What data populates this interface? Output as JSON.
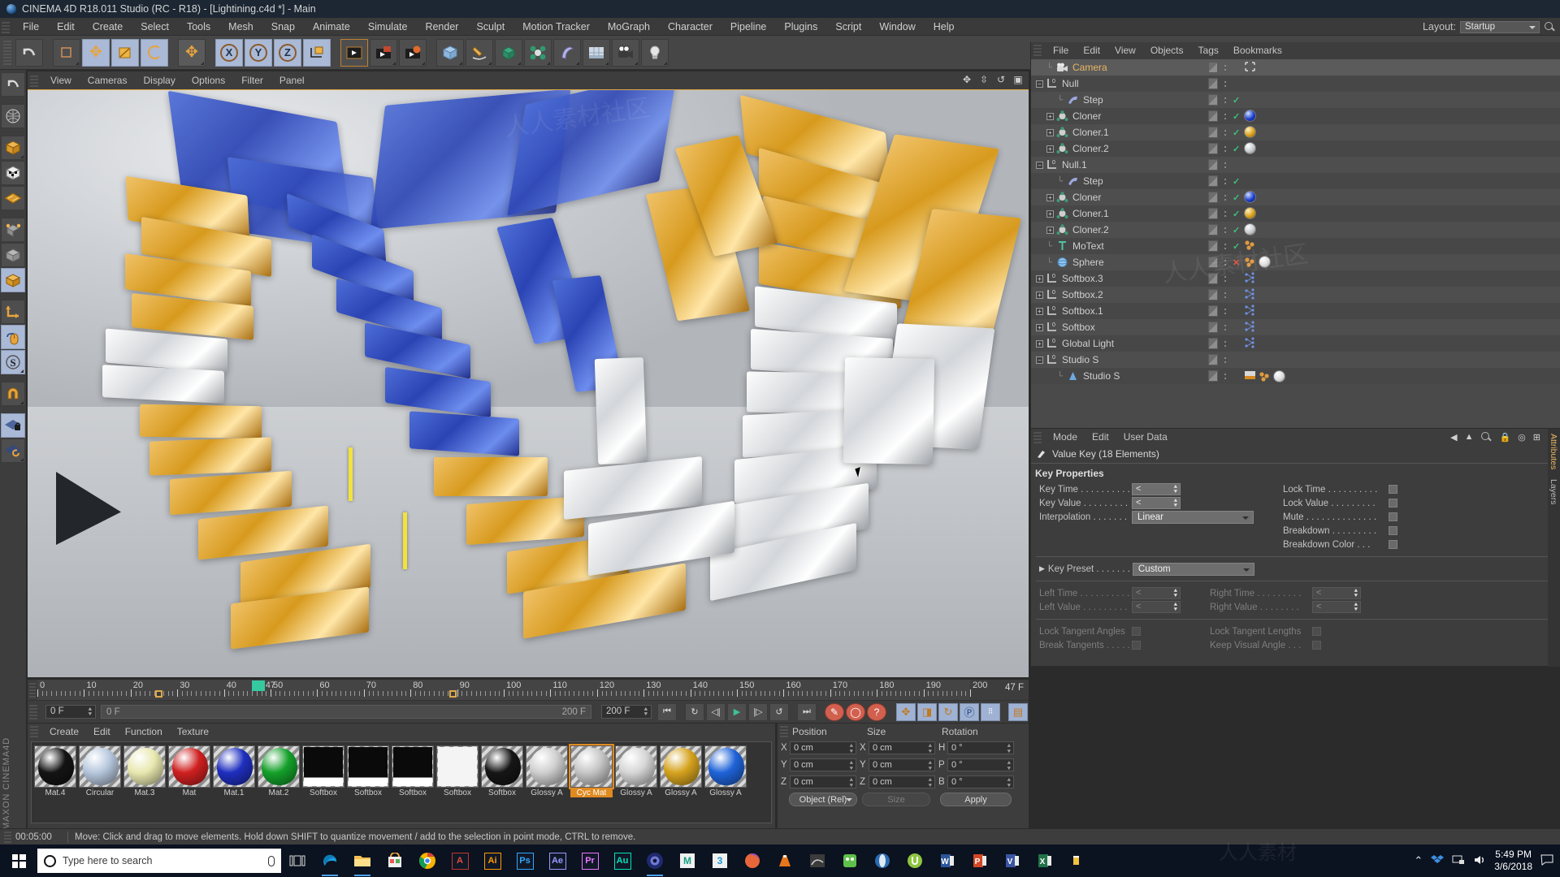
{
  "window": {
    "title": "CINEMA 4D R18.011 Studio (RC - R18) - [Lightining.c4d *] - Main"
  },
  "menubar": {
    "items": [
      "File",
      "Edit",
      "Create",
      "Select",
      "Tools",
      "Mesh",
      "Snap",
      "Animate",
      "Simulate",
      "Render",
      "Sculpt",
      "Motion Tracker",
      "MoGraph",
      "Character",
      "Pipeline",
      "Plugins",
      "Script",
      "Window",
      "Help"
    ],
    "layout_label": "Layout:",
    "layout_value": "Startup"
  },
  "toolbar": {
    "icons": [
      "undo-icon",
      "live-selection-icon",
      "move-icon",
      "scale-icon",
      "rotate-icon",
      "move-axis-icon",
      "axis-x-icon",
      "axis-y-icon",
      "axis-z-icon",
      "world-object-axis-icon",
      "render-view-icon",
      "render-region-icon",
      "render-picture-viewer-icon",
      "render-settings-icon",
      "cube-primitive-icon",
      "spline-pen-icon",
      "nurbs-icon",
      "array-icon",
      "bend-deformer-icon",
      "floor-icon",
      "camera-icon",
      "light-icon"
    ]
  },
  "left_toolbar": {
    "icons": [
      "undo-icon",
      "make-editable-icon",
      "model-mode-icon",
      "texture-mode-icon",
      "points-mode-icon",
      "object-axis-icon",
      "edge-mode-icon",
      "polygon-mode-icon",
      "world-coordinates-icon",
      "viewport-solo-icon",
      "enable-snap-icon",
      "magnet-icon",
      "workplane-lock-icon",
      "workplane-rotate-icon"
    ],
    "brand": "MAXON  CINEMA4D"
  },
  "viewport": {
    "menu": [
      "View",
      "Cameras",
      "Display",
      "Options",
      "Filter",
      "Panel"
    ],
    "icons": [
      "pan-icon",
      "dolly-icon",
      "rotate-icon",
      "layout-icon"
    ]
  },
  "timeline": {
    "ticks": [
      0,
      10,
      20,
      30,
      40,
      50,
      60,
      70,
      80,
      90,
      100,
      110,
      120,
      130,
      140,
      150,
      160,
      170,
      180,
      190,
      200
    ],
    "current_frame_marker": "47",
    "current_frame_field": "47 F",
    "start_field": "0 F",
    "scrub_left": "0 F",
    "scrub_right": "200 F",
    "end_field": "200 F",
    "transport": [
      "go-to-start-icon",
      "play-backwards-icon",
      "previous-frame-icon",
      "play-forwards-icon",
      "next-frame-icon",
      "loop-icon",
      "go-to-end-icon",
      "record-active-objects-icon",
      "autokeying-icon",
      "keyframe-selection-icon",
      "position-key-icon",
      "scale-key-icon",
      "rotation-key-icon",
      "parameter-key-icon",
      "point-level-key-icon",
      "timeline-icon"
    ]
  },
  "material_manager": {
    "menu": [
      "Create",
      "Edit",
      "Function",
      "Texture"
    ],
    "materials": [
      {
        "name": "Mat.4",
        "color": "#141414",
        "selected": false,
        "kind": "ball"
      },
      {
        "name": "Circular",
        "color": "#b6c7dd",
        "selected": false,
        "kind": "ball"
      },
      {
        "name": "Mat.3",
        "color": "#e8e8b0",
        "selected": false,
        "kind": "ball"
      },
      {
        "name": "Mat",
        "color": "#cf2020",
        "selected": false,
        "kind": "ball"
      },
      {
        "name": "Mat.1",
        "color": "#1f2fbf",
        "selected": false,
        "kind": "ball"
      },
      {
        "name": "Mat.2",
        "color": "#14a02a",
        "selected": false,
        "kind": "ball"
      },
      {
        "name": "Softbox",
        "color": "#0a0a0a",
        "selected": false,
        "kind": "flat"
      },
      {
        "name": "Softbox",
        "color": "#0a0a0a",
        "selected": false,
        "kind": "flat"
      },
      {
        "name": "Softbox",
        "color": "#0a0a0a",
        "selected": false,
        "kind": "flat"
      },
      {
        "name": "Softbox",
        "color": "#f4f4f4",
        "selected": false,
        "kind": "flat"
      },
      {
        "name": "Softbox",
        "color": "#161616",
        "selected": false,
        "kind": "ball"
      },
      {
        "name": "Glossy A",
        "color": "#cfcfcf",
        "selected": false,
        "kind": "ball"
      },
      {
        "name": "Cyc Mat",
        "color": "#c6c6c6",
        "selected": true,
        "kind": "ball"
      },
      {
        "name": "Glossy A",
        "color": "#d6d6d6",
        "selected": false,
        "kind": "ball"
      },
      {
        "name": "Glossy A",
        "color": "#d6a31e",
        "selected": false,
        "kind": "ball"
      },
      {
        "name": "Glossy A",
        "color": "#1f63d8",
        "selected": false,
        "kind": "ball"
      }
    ]
  },
  "coordinates": {
    "headers": [
      "Position",
      "Size",
      "Rotation"
    ],
    "rows": [
      {
        "axis": "X",
        "position": "0 cm",
        "sizeaxis": "X",
        "size": "0 cm",
        "rotaxis": "H",
        "rotation": "0 °"
      },
      {
        "axis": "Y",
        "position": "0 cm",
        "sizeaxis": "Y",
        "size": "0 cm",
        "rotaxis": "P",
        "rotation": "0 °"
      },
      {
        "axis": "Z",
        "position": "0 cm",
        "sizeaxis": "Z",
        "size": "0 cm",
        "rotaxis": "B",
        "rotation": "0 °"
      }
    ],
    "mode_dropdown": "Object (Rel)",
    "size_dropdown": "Size",
    "apply_button": "Apply"
  },
  "object_manager": {
    "menu": [
      "File",
      "Edit",
      "View",
      "Objects",
      "Tags",
      "Bookmarks"
    ],
    "rows": [
      {
        "name": "Camera",
        "icon": "camera-icon",
        "indent": 1,
        "expander": "none",
        "selected": true,
        "check": "",
        "tags": [
          "target-tag"
        ]
      },
      {
        "name": "Null",
        "icon": "null-icon",
        "indent": 0,
        "expander": "minus",
        "selected": false,
        "check": "",
        "tags": []
      },
      {
        "name": "Step",
        "icon": "step-effector-icon",
        "indent": 2,
        "expander": "none",
        "selected": false,
        "check": "yes",
        "tags": []
      },
      {
        "name": "Cloner",
        "icon": "cloner-icon",
        "indent": 1,
        "expander": "plus",
        "selected": false,
        "check": "yes",
        "tags": [
          "mat-blue"
        ]
      },
      {
        "name": "Cloner.1",
        "icon": "cloner-icon",
        "indent": 1,
        "expander": "plus",
        "selected": false,
        "check": "yes",
        "tags": [
          "mat-gold"
        ]
      },
      {
        "name": "Cloner.2",
        "icon": "cloner-icon",
        "indent": 1,
        "expander": "plus",
        "selected": false,
        "check": "yes",
        "tags": [
          "mat-silver"
        ]
      },
      {
        "name": "Null.1",
        "icon": "null-icon",
        "indent": 0,
        "expander": "minus",
        "selected": false,
        "check": "",
        "tags": []
      },
      {
        "name": "Step",
        "icon": "step-effector-icon",
        "indent": 2,
        "expander": "none",
        "selected": false,
        "check": "yes",
        "tags": []
      },
      {
        "name": "Cloner",
        "icon": "cloner-icon",
        "indent": 1,
        "expander": "plus",
        "selected": false,
        "check": "yes",
        "tags": [
          "mat-blue"
        ]
      },
      {
        "name": "Cloner.1",
        "icon": "cloner-icon",
        "indent": 1,
        "expander": "plus",
        "selected": false,
        "check": "yes",
        "tags": [
          "mat-gold"
        ]
      },
      {
        "name": "Cloner.2",
        "icon": "cloner-icon",
        "indent": 1,
        "expander": "plus",
        "selected": false,
        "check": "yes",
        "tags": [
          "mat-silver"
        ]
      },
      {
        "name": "MoText",
        "icon": "motext-icon",
        "indent": 1,
        "expander": "none",
        "selected": false,
        "check": "yes",
        "tags": [
          "mograph-tag"
        ]
      },
      {
        "name": "Sphere",
        "icon": "sphere-icon",
        "indent": 1,
        "expander": "none",
        "selected": false,
        "check": "no",
        "tags": [
          "mograph-tag",
          "mat-white"
        ]
      },
      {
        "name": "Softbox.3",
        "icon": "null-icon",
        "indent": 0,
        "expander": "plus",
        "selected": false,
        "check": "",
        "tags": [
          "xpresso-tag"
        ]
      },
      {
        "name": "Softbox.2",
        "icon": "null-icon",
        "indent": 0,
        "expander": "plus",
        "selected": false,
        "check": "",
        "tags": [
          "xpresso-tag"
        ]
      },
      {
        "name": "Softbox.1",
        "icon": "null-icon",
        "indent": 0,
        "expander": "plus",
        "selected": false,
        "check": "",
        "tags": [
          "xpresso-tag"
        ]
      },
      {
        "name": "Softbox",
        "icon": "null-icon",
        "indent": 0,
        "expander": "plus",
        "selected": false,
        "check": "",
        "tags": [
          "xpresso-tag"
        ]
      },
      {
        "name": "Global Light",
        "icon": "null-icon",
        "indent": 0,
        "expander": "plus",
        "selected": false,
        "check": "",
        "tags": [
          "xpresso-tag"
        ]
      },
      {
        "name": "Studio S",
        "icon": "null-icon",
        "indent": 0,
        "expander": "minus",
        "selected": false,
        "check": "",
        "tags": []
      },
      {
        "name": "Studio S",
        "icon": "light-icon",
        "indent": 2,
        "expander": "none",
        "selected": false,
        "check": "",
        "tags": [
          "gradient-tag",
          "mograph-tag",
          "mat-white"
        ]
      }
    ]
  },
  "attributes": {
    "menu": [
      "Mode",
      "Edit",
      "User Data"
    ],
    "object_title": "Value Key (18 Elements)",
    "section_title": "Key Properties",
    "left_fields": [
      {
        "label": "Key Time . . . . . . . . . .",
        "value": "<<Multip",
        "type": "spin"
      },
      {
        "label": "Key Value . . . . . . . . .",
        "value": "<<Multip",
        "type": "spin"
      },
      {
        "label": "Interpolation . . . . . . .",
        "value": "Linear",
        "type": "dropdown"
      }
    ],
    "right_fields": [
      {
        "label": "Lock Time . . . . . . . . . .",
        "checked": false
      },
      {
        "label": "Lock Value . . . . . . . . .",
        "checked": false
      },
      {
        "label": "Mute . . . . . . . . . . . . . .",
        "checked": false
      },
      {
        "label": "Breakdown . . . . . . . . .",
        "checked": false
      },
      {
        "label": "Breakdown Color . . .",
        "checked": false
      }
    ],
    "key_preset_label": "Key Preset . . . . . . . . .",
    "key_preset_value": "Custom",
    "tangent_rows": [
      {
        "left_label": "Left  Time . . . . . . . . . .",
        "left_value": "<<Multip",
        "right_label": "Right Time . . . . . . . . .",
        "right_value": "<<Multip"
      },
      {
        "left_label": "Left  Value . . . . . . . . .",
        "left_value": "<<Multip",
        "right_label": "Right Value . . . . . . . .",
        "right_value": "<<Multip"
      }
    ],
    "tangent_checks": [
      {
        "left_label": "Lock Tangent Angles",
        "right_label": "Lock Tangent Lengths"
      },
      {
        "left_label": "Break Tangents . . . . .",
        "right_label": "Keep Visual Angle . . ."
      }
    ],
    "side_tabs": [
      "Attributes",
      "Layers"
    ]
  },
  "statusbar": {
    "time": "00:05:00",
    "message": "Move: Click and drag to move elements. Hold down SHIFT to quantize movement / add to the selection in point mode, CTRL to remove."
  },
  "taskbar": {
    "search_placeholder": "Type here to search",
    "icons": [
      "windows-start-icon",
      "cortana-icon",
      "microphone-icon",
      "task-view-icon",
      "edge-icon",
      "file-explorer-icon",
      "microsoft-store-icon",
      "chrome-icon",
      "acrobat-icon",
      "illustrator-icon",
      "photoshop-icon",
      "after-effects-icon",
      "premiere-icon",
      "audition-icon",
      "cinema4d-icon",
      "maya-icon",
      "3dsmax-icon",
      "firefox-icon",
      "vlc-icon",
      "sketch-icon",
      "utorrent-icon",
      "opera-icon",
      "utorrent-icon2",
      "word-icon",
      "powerpoint-icon",
      "visio-icon",
      "excel-icon",
      "misc-icon"
    ],
    "adobe_apps": [
      {
        "label": "Ai",
        "color": "#ff9a00"
      },
      {
        "label": "Ps",
        "color": "#31a8ff"
      },
      {
        "label": "Ae",
        "color": "#9999ff"
      },
      {
        "label": "Pr",
        "color": "#ea77ff"
      },
      {
        "label": "Au",
        "color": "#00e4bb"
      }
    ],
    "clock_time": "5:49 PM",
    "clock_date": "3/6/2018"
  }
}
